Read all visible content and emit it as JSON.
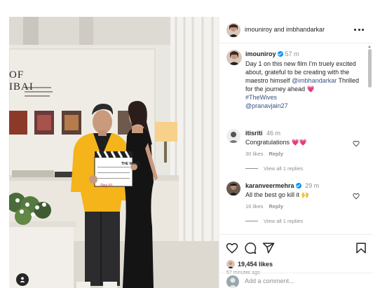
{
  "post": {
    "wall_text_line1": "OF",
    "wall_text_line2": "IBAI",
    "clapper_title": "THE WIVES",
    "clapper_day": "Day 01"
  },
  "header": {
    "title": "imouniroy and imbhandarkar"
  },
  "caption": {
    "username": "imouniroy",
    "time": "57 m",
    "text_1": "Day 1 on this new film I'm truely excited about, grateful to be creating with the maestro himself",
    "mention_1": "@imbhandarkar",
    "text_2": " Thrilled for the journey ahead ",
    "emoji_1": "💗",
    "hashtag": "#TheWives",
    "mention_2": "@pranavjain27"
  },
  "comments": [
    {
      "username": "itisriti",
      "time": "46 m",
      "text": "Congratulations ",
      "emoji": "💗💗",
      "likes": "30 likes",
      "reply_label": "Reply",
      "view_replies": "View all 1 replies"
    },
    {
      "username": "karanveermehra",
      "time": "29 m",
      "text": "All the best go kill it ",
      "emoji": "🙌",
      "likes": "16 likes",
      "reply_label": "Reply",
      "view_replies": "View all 1 replies"
    }
  ],
  "actions": {
    "likes_count": "19,454 likes",
    "posted_time": "57 minutes ago",
    "add_comment_placeholder": "Add a comment..."
  },
  "colors": {
    "verified": "#0095f6",
    "link": "#385185",
    "meta_text": "#8e8e8e",
    "jacket": "#f4b41a"
  },
  "icons": [
    "more-icon",
    "verified-icon",
    "heart-icon",
    "comment-icon",
    "share-icon",
    "bookmark-icon",
    "user-tag-icon"
  ]
}
